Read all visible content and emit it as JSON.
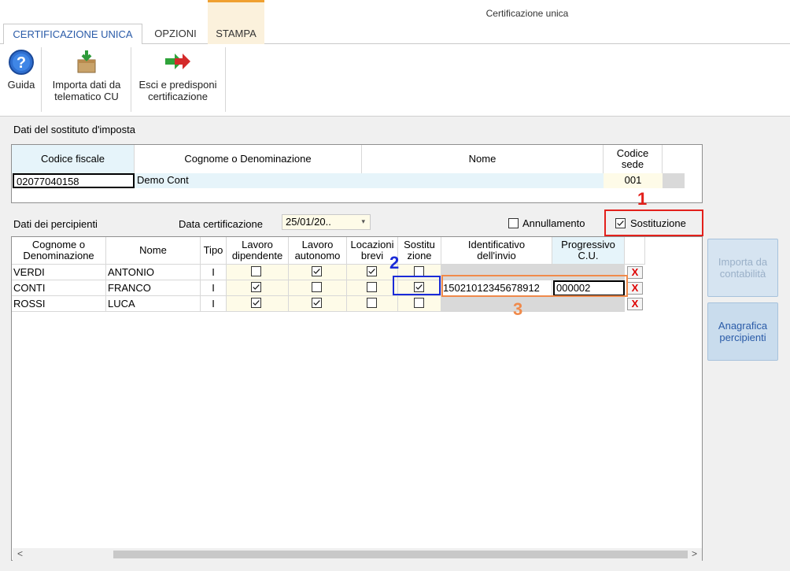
{
  "window": {
    "title": "Certificazione unica"
  },
  "ribbon": {
    "tabs": [
      {
        "label": "CERTIFICAZIONE UNICA",
        "active": true
      },
      {
        "label": "OPZIONI",
        "active": false
      },
      {
        "label": "STAMPA",
        "active": false
      }
    ],
    "buttons": [
      {
        "label": "Guida",
        "icon": "help-icon"
      },
      {
        "label_line1": "Importa dati da",
        "label_line2": "telematico CU",
        "icon": "import-box-icon"
      },
      {
        "label_line1": "Esci e predisponi",
        "label_line2": "certificazione",
        "icon": "arrow-exit-icon"
      }
    ]
  },
  "sostituto": {
    "section_label": "Dati del sostituto d'imposta",
    "headers": {
      "codice_fiscale": "Codice fiscale",
      "cognome": "Cognome o Denominazione",
      "nome": "Nome",
      "codice_sede_1": "Codice",
      "codice_sede_2": "sede"
    },
    "row": {
      "codice_fiscale": "02077040158",
      "cognome": "Demo Cont",
      "nome": "",
      "codice_sede": "001"
    }
  },
  "percipienti": {
    "section_label": "Dati dei percipienti",
    "data_certificazione_label": "Data certificazione",
    "data_certificazione_value": "25/01/20..",
    "annullamento_label": "Annullamento",
    "annullamento_checked": false,
    "sostituzione_label": "Sostituzione",
    "sostituzione_checked": true,
    "headers": {
      "cognome_1": "Cognome o",
      "cognome_2": "Denominazione",
      "nome": "Nome",
      "tipo": "Tipo",
      "lav_dip_1": "Lavoro",
      "lav_dip_2": "dipendente",
      "lav_aut_1": "Lavoro",
      "lav_aut_2": "autonomo",
      "loc_1": "Locazioni",
      "loc_2": "brevi",
      "sost_1": "Sostitu",
      "sost_2": "zione",
      "ident_1": "Identificativo",
      "ident_2": "dell'invio",
      "prog_1": "Progressivo",
      "prog_2": "C.U."
    },
    "rows": [
      {
        "cognome": "VERDI",
        "nome": "ANTONIO",
        "tipo": "I",
        "lav_dip": false,
        "lav_aut": true,
        "loc": true,
        "sost": false,
        "ident": "",
        "prog": "",
        "delete": "X"
      },
      {
        "cognome": "CONTI",
        "nome": "FRANCO",
        "tipo": "I",
        "lav_dip": true,
        "lav_aut": false,
        "loc": false,
        "sost": true,
        "ident": "15021012345678912",
        "prog": "000002",
        "delete": "X"
      },
      {
        "cognome": "ROSSI",
        "nome": "LUCA",
        "tipo": "I",
        "lav_dip": true,
        "lav_aut": true,
        "loc": false,
        "sost": false,
        "ident": "",
        "prog": "",
        "delete": "X"
      }
    ]
  },
  "side_buttons": {
    "importa_1": "Importa da",
    "importa_2": "contabilità",
    "anagrafica_1": "Anagrafica",
    "anagrafica_2": "percipienti"
  },
  "annotations": {
    "n1": "1",
    "n2": "2",
    "n3": "3",
    "color1": "#e3201b",
    "color2": "#1a2bd8",
    "color3": "#f08a4b"
  },
  "scroll": {
    "left": "<",
    "right": ">"
  }
}
